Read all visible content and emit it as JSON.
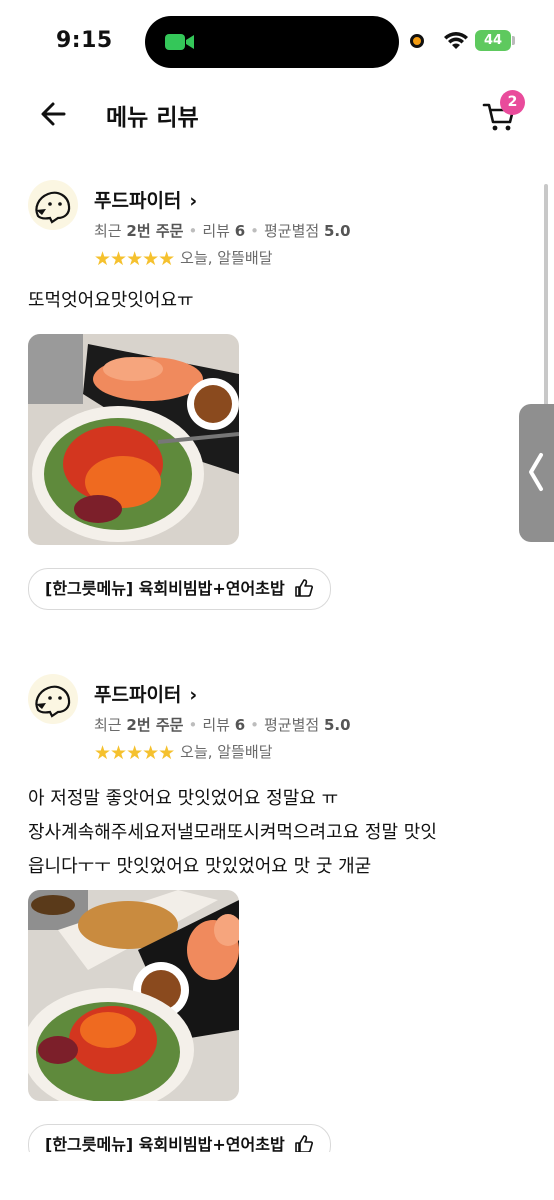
{
  "status_bar": {
    "time": "9:15",
    "battery": "44"
  },
  "header": {
    "title": "메뉴 리뷰",
    "cart_count": "2"
  },
  "reviews": [
    {
      "author": "푸드파이터",
      "recent_label": "최근",
      "recent_orders": "2번 주문",
      "review_label": "리뷰",
      "review_count": "6",
      "avg_label": "평균별점",
      "avg_rating": "5.0",
      "stars": "★★★★★",
      "delivery": "오늘, 알뜰배달",
      "text": "또먹엇어요맛잇어요ㅠ",
      "menu_chip": "[한그릇메뉴] 육회비빔밥+연어초밥"
    },
    {
      "author": "푸드파이터",
      "recent_label": "최근",
      "recent_orders": "2번 주문",
      "review_label": "리뷰",
      "review_count": "6",
      "avg_label": "평균별점",
      "avg_rating": "5.0",
      "stars": "★★★★★",
      "delivery": "오늘, 알뜰배달",
      "text_lines": [
        "아 저정말 좋앗어요 맛잇었어요 정말요 ㅠ",
        "장사계속해주세요저낼모래또시켜먹으려고요 정말 맛잇",
        "읍니다ㅜㅜ 맛잇었어요 맛있었어요 맛 굿 개굳"
      ],
      "menu_chip": "[한그릇메뉴] 육회비빔밥+연어초밥"
    }
  ],
  "colors": {
    "star": "#f5c12e",
    "badge": "#e94b9b",
    "battery": "#5ec95e"
  }
}
